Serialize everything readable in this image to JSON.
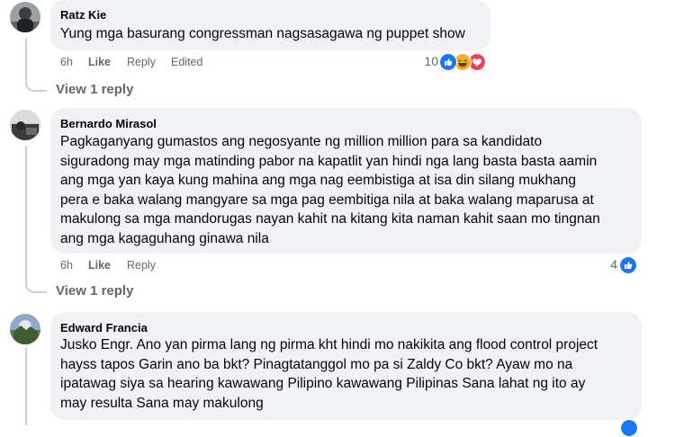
{
  "comments": [
    {
      "author": "Ratz Kie",
      "text": "Yung mga basurang congressman nagsasagawa ng puppet show",
      "time": "6h",
      "like_label": "Like",
      "reply_label": "Reply",
      "edited_label": "Edited",
      "reaction_count": "10",
      "reactions": [
        "like-icon",
        "haha-icon",
        "love-icon"
      ],
      "view_replies": "View 1 reply"
    },
    {
      "author": "Bernardo Mirasol",
      "text_lines": [
        "Pagkaganyang gumastos ang negosyante ng million million para sa kandidato",
        "siguradong may mga matinding pabor na kapatlit yan hindi nga lang basta basta aamin",
        "ang mga yan kaya kung mahina ang mga nag eembistiga at isa din silang mukhang",
        "pera e baka walang mangyare sa mga pag eembitiga nila at baka walang maparusa at",
        "makulong sa mga mandorugas nayan kahit na kitang kita naman kahit saan mo tingnan",
        "ang mga kagaguhang ginawa nila"
      ],
      "time": "6h",
      "like_label": "Like",
      "reply_label": "Reply",
      "reaction_count": "4",
      "reactions": [
        "like-icon"
      ],
      "view_replies": "View 1 reply"
    },
    {
      "author": "Edward Francia",
      "text_lines": [
        "Jusko Engr. Ano yan pirma lang ng pirma kht hindi mo nakikita ang flood control project",
        "hayss tapos Garin ano ba bkt? Pinagtatanggol mo pa si Zaldy Co bkt? Ayaw mo na",
        "ipatawag siya sa hearing kawawang Pilipino kawawang Pilipinas Sana lahat ng ito ay",
        "may resulta Sana may makulong"
      ]
    }
  ],
  "colors": {
    "bubble": "#f0f2f5",
    "meta_text": "#65676b",
    "like_blue": "#1877f2",
    "love_red": "#f33e58",
    "haha_yellow": "#f7b125"
  }
}
